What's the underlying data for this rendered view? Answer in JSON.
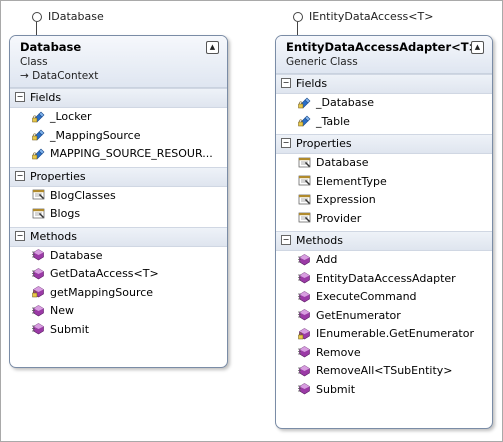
{
  "interfaces": [
    {
      "label": "IDatabase"
    },
    {
      "label": "IEntityDataAccess<T>"
    }
  ],
  "database": {
    "title": "Database",
    "kind": "Class",
    "base": "→ DataContext",
    "fields_label": "Fields",
    "fields": [
      "_Locker",
      "_MappingSource",
      "MAPPING_SOURCE_RESOUR..."
    ],
    "properties_label": "Properties",
    "properties": [
      "BlogClasses",
      "Blogs"
    ],
    "methods_label": "Methods",
    "methods": [
      "Database",
      "GetDataAccess<T>",
      "getMappingSource",
      "New",
      "Submit"
    ]
  },
  "adapter": {
    "title": "EntityDataAccessAdapter<T>",
    "kind": "Generic Class",
    "fields_label": "Fields",
    "fields": [
      "_Database",
      "_Table"
    ],
    "properties_label": "Properties",
    "properties": [
      "Database",
      "ElementType",
      "Expression",
      "Provider"
    ],
    "methods_label": "Methods",
    "methods": [
      "Add",
      "EntityDataAccessAdapter",
      "ExecuteCommand",
      "GetEnumerator",
      "IEnumerable.GetEnumerator",
      "Remove",
      "RemoveAll<TSubEntity>",
      "Submit"
    ]
  },
  "colors": {
    "field_icon": "#2a6fc9",
    "property_icon": "#b08a2c",
    "method_icon": "#9b3aa6"
  }
}
